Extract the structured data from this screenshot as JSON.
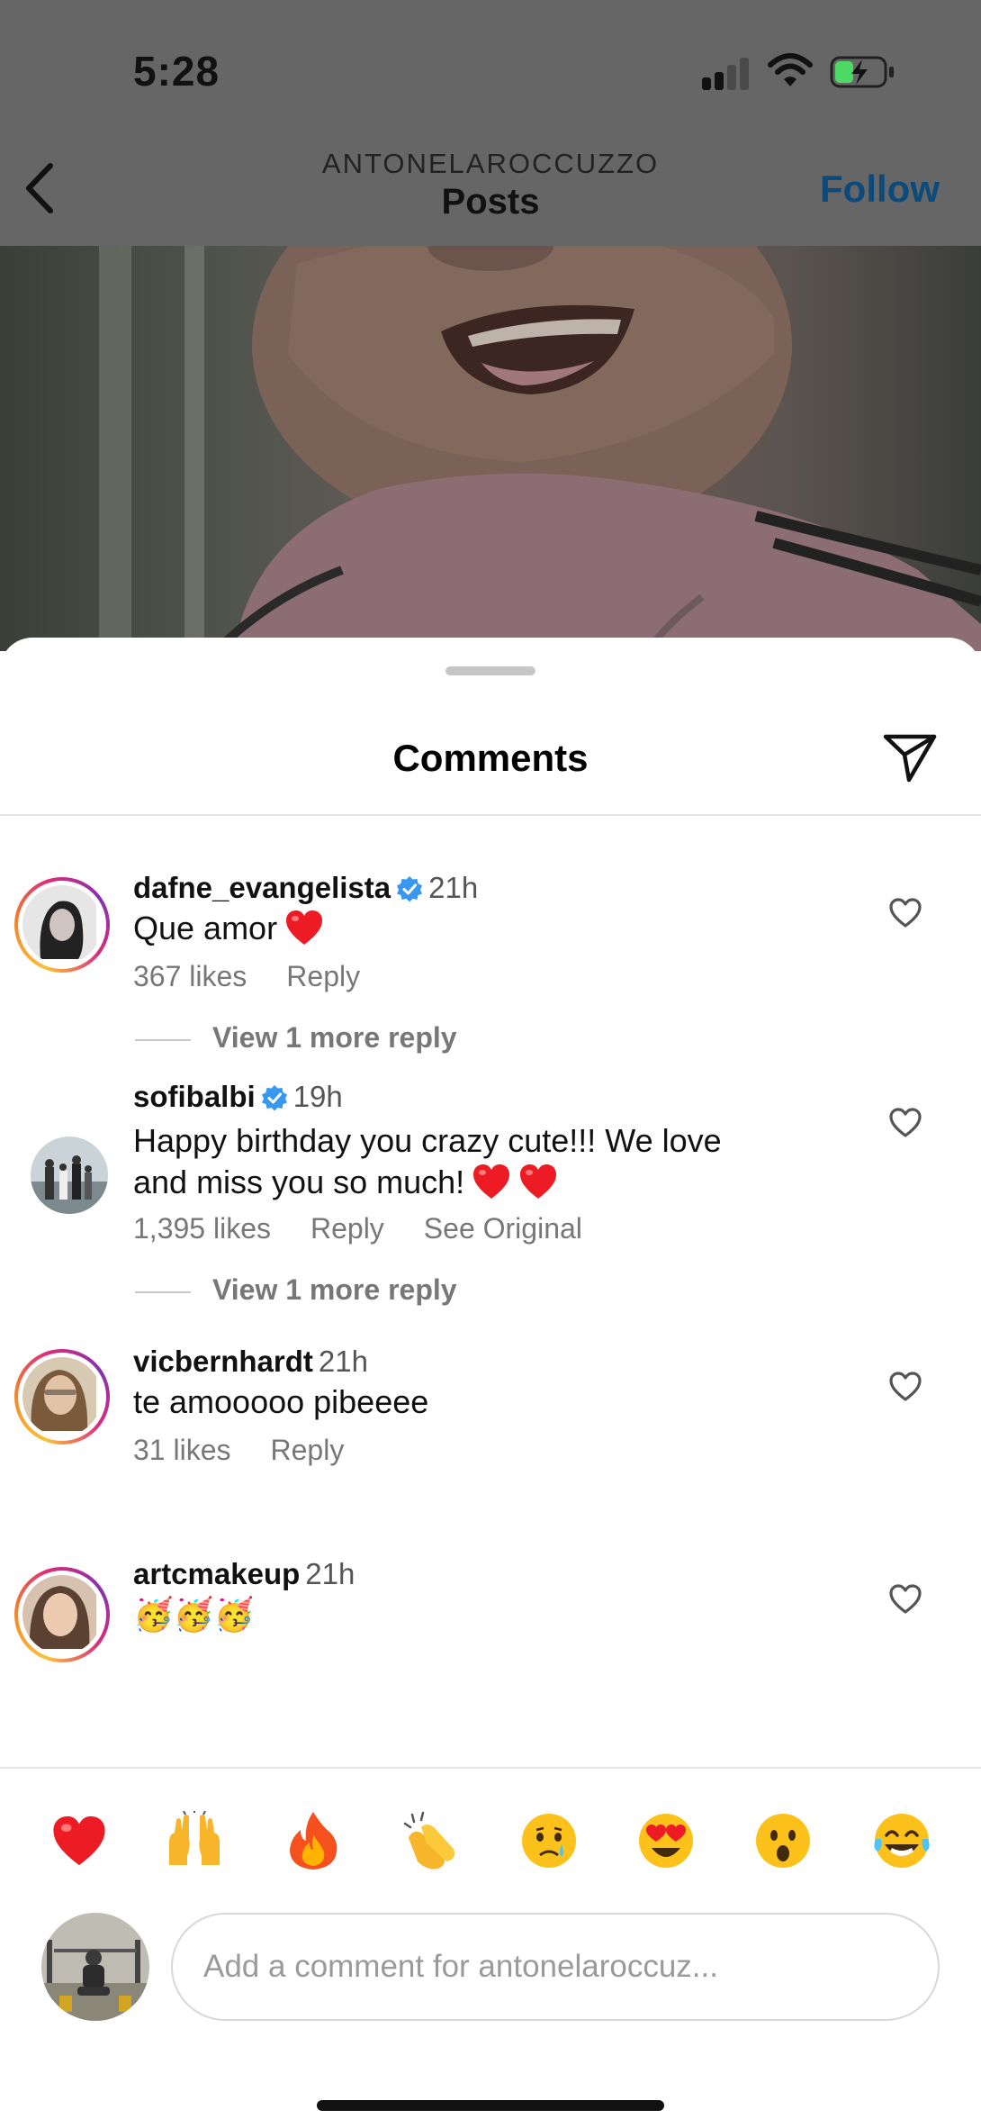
{
  "status_bar": {
    "time": "5:28",
    "icons": [
      "cellular-signal-icon",
      "wifi-icon",
      "battery-charging-icon"
    ]
  },
  "header": {
    "account": "ANTONELAROCCUZZO",
    "title": "Posts",
    "follow_label": "Follow",
    "back_icon": "chevron-left-icon"
  },
  "sheet": {
    "title": "Comments",
    "share_icon": "paper-plane-icon"
  },
  "comments": [
    {
      "username": "dafne_evangelista",
      "verified": true,
      "time": "21h",
      "text": "Que amor",
      "emoji": [
        "❤️"
      ],
      "likes": "367 likes",
      "reply_label": "Reply",
      "view_replies": "View 1 more reply"
    },
    {
      "username": "sofibalbi",
      "verified": true,
      "time": "19h",
      "text_line1": "Happy birthday you crazy cute!!! We love",
      "text_line2": "and miss you so much!",
      "emoji": [
        "❤️",
        "❤️"
      ],
      "likes": "1,395 likes",
      "reply_label": "Reply",
      "see_original": "See Original",
      "view_replies": "View 1 more reply"
    },
    {
      "username": "vicbernhardt",
      "verified": false,
      "time": "21h",
      "text": "te amooooo pibeeee",
      "likes": "31 likes",
      "reply_label": "Reply"
    },
    {
      "username": "artcmakeup",
      "verified": false,
      "time": "21h",
      "text": "🥳🥳🥳"
    }
  ],
  "quick_reactions": [
    "❤️",
    "🙌",
    "🔥",
    "👏",
    "😢",
    "😍",
    "😮",
    "😂"
  ],
  "composer": {
    "placeholder": "Add a comment for antonelaroccuz..."
  },
  "colors": {
    "follow": "#0b4a7a",
    "verified": "#3897f0",
    "heart": "#ed1c24",
    "muted_text": "#777777"
  }
}
